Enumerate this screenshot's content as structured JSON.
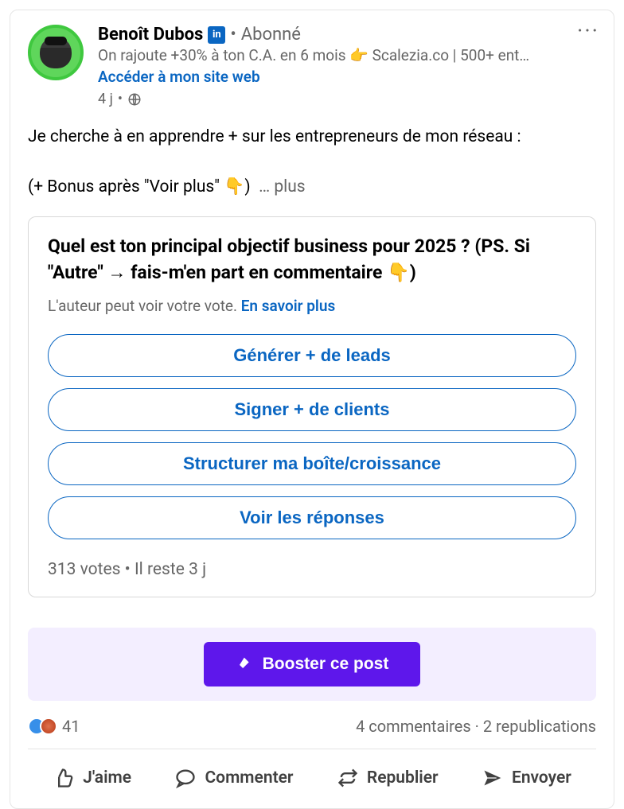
{
  "header": {
    "name": "Benoît Dubos",
    "badge": "in",
    "follower_status": "Abonné",
    "headline": "On rajoute +30% à ton C.A. en 6 mois 👉 Scalezia.co | 500+ ent…",
    "site_link": "Accéder à mon site web",
    "time": "4 j",
    "separator": "•"
  },
  "post": {
    "line1": "Je cherche à en apprendre + sur les entrepreneurs de mon réseau :",
    "line2": "(+ Bonus après \"Voir plus\" 👇)",
    "see_more": "… plus"
  },
  "poll": {
    "question": "Quel est ton principal objectif business pour 2025 ? (PS. Si \"Autre\" → fais-m'en part en commentaire 👇)",
    "note_text": "L'auteur peut voir votre vote. ",
    "note_link": "En savoir plus",
    "options": [
      "Générer + de leads",
      "Signer + de clients",
      "Structurer ma boîte/croissance",
      "Voir les réponses"
    ],
    "stats": "313 votes • Il reste 3 j"
  },
  "boost": {
    "label": "Booster ce post"
  },
  "reactions": {
    "count": "41",
    "comments": "4 commentaires",
    "reposts": "2 republications",
    "dot": " · "
  },
  "actions": {
    "like": "J'aime",
    "comment": "Commenter",
    "repost": "Republier",
    "send": "Envoyer"
  }
}
